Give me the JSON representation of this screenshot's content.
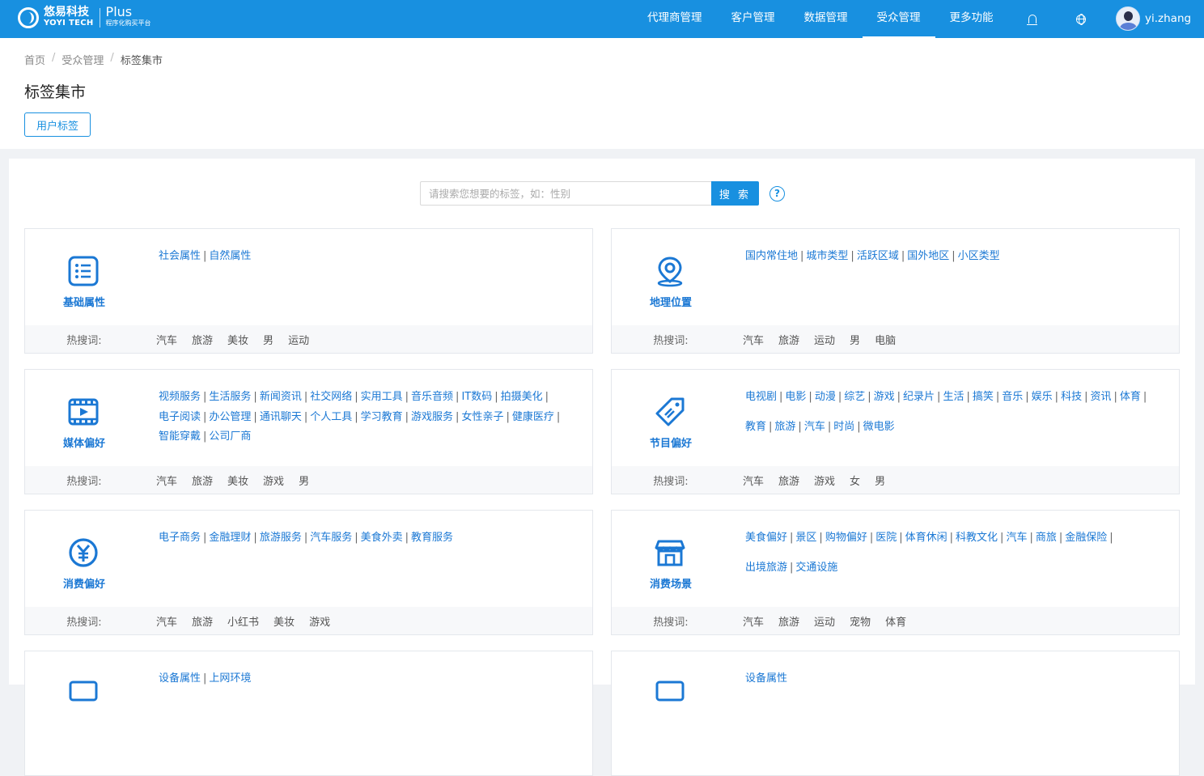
{
  "app": {
    "logo_cn": "悠易科技",
    "logo_en": "YOYI TECH",
    "plus": "Plus",
    "plus_sub": "程序化购买平台"
  },
  "nav": {
    "items": [
      "代理商管理",
      "客户管理",
      "数据管理",
      "受众管理",
      "更多功能"
    ],
    "active": "受众管理",
    "username": "yi.zhang"
  },
  "breadcrumb": [
    "首页",
    "受众管理",
    "标签集市"
  ],
  "page_title": "标签集市",
  "tab_button": "用户标签",
  "search": {
    "placeholder": "请搜索您想要的标签，如：性别",
    "button": "搜 索",
    "help": "?"
  },
  "hot_label": "热搜词:",
  "colors": {
    "primary": "#1890e0",
    "link": "#1b78d4"
  },
  "cards": [
    {
      "title": "基础属性",
      "icon": "list-icon",
      "links": [
        "社会属性",
        "自然属性"
      ],
      "hot": [
        "汽车",
        "旅游",
        "美妆",
        "男",
        "运动"
      ]
    },
    {
      "title": "地理位置",
      "icon": "location-pin-icon",
      "links": [
        "国内常住地",
        "城市类型",
        "活跃区域",
        "国外地区",
        "小区类型"
      ],
      "hot": [
        "汽车",
        "旅游",
        "运动",
        "男",
        "电脑"
      ]
    },
    {
      "title": "媒体偏好",
      "icon": "video-icon",
      "links": [
        "视频服务",
        "生活服务",
        "新闻资讯",
        "社交网络",
        "实用工具",
        "音乐音频",
        "IT数码",
        "拍摄美化",
        "电子阅读",
        "办公管理",
        "通讯聊天",
        "个人工具",
        "学习教育",
        "游戏服务",
        "女性亲子",
        "健康医疗",
        "智能穿戴",
        "公司厂商"
      ],
      "hot": [
        "汽车",
        "旅游",
        "美妆",
        "游戏",
        "男"
      ]
    },
    {
      "title": "节目偏好",
      "icon": "tag-icon",
      "links": [
        "电视剧",
        "电影",
        "动漫",
        "综艺",
        "游戏",
        "纪录片",
        "生活",
        "搞笑",
        "音乐",
        "娱乐",
        "科技",
        "资讯",
        "体育",
        "教育",
        "旅游",
        "汽车",
        "时尚",
        "微电影"
      ],
      "hot": [
        "汽车",
        "旅游",
        "游戏",
        "女",
        "男"
      ]
    },
    {
      "title": "消费偏好",
      "icon": "yen-icon",
      "links": [
        "电子商务",
        "金融理财",
        "旅游服务",
        "汽车服务",
        "美食外卖",
        "教育服务"
      ],
      "hot": [
        "汽车",
        "旅游",
        "小红书",
        "美妆",
        "游戏"
      ]
    },
    {
      "title": "消费场景",
      "icon": "store-icon",
      "links": [
        "美食偏好",
        "景区",
        "购物偏好",
        "医院",
        "体育休闲",
        "科教文化",
        "汽车",
        "商旅",
        "金融保险",
        "出境旅游",
        "交通设施"
      ],
      "hot": [
        "汽车",
        "旅游",
        "运动",
        "宠物",
        "体育"
      ]
    },
    {
      "title": "",
      "icon": "device-icon",
      "links": [
        "设备属性",
        "上网环境"
      ],
      "hot": []
    },
    {
      "title": "",
      "icon": "device-icon",
      "links": [
        "设备属性"
      ],
      "hot": []
    }
  ]
}
